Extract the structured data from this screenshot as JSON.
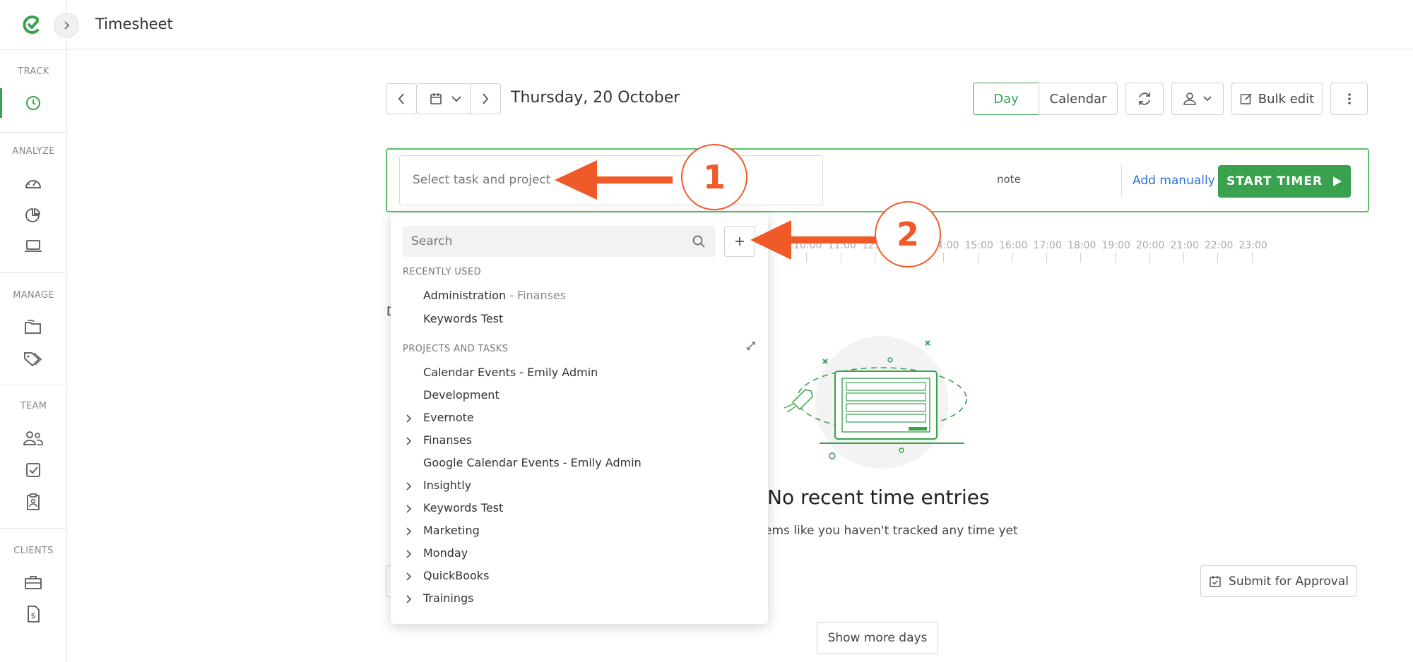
{
  "header": {
    "title": "Timesheet"
  },
  "sidebar": {
    "sections": [
      "TRACK",
      "ANALYZE",
      "MANAGE",
      "TEAM",
      "CLIENTS"
    ],
    "icons": [
      "clock-icon",
      "dashboard-icon",
      "report-icon",
      "activity-icon",
      "folder-icon",
      "tag-icon",
      "people-icon",
      "checkbox-icon",
      "clipboard-icon",
      "briefcase-icon",
      "invoice-icon"
    ]
  },
  "toolbar": {
    "date": "Thursday, 20 October",
    "view_day": "Day",
    "view_calendar": "Calendar",
    "bulk_edit": "Bulk edit"
  },
  "timer": {
    "task_placeholder": "Select task and project",
    "note": "note",
    "add_manually": "Add manually",
    "start_timer": "START TIMER"
  },
  "timeline": {
    "hours": [
      "10:00",
      "11:00",
      "12:00",
      "13:00",
      "14:00",
      "15:00",
      "16:00",
      "17:00",
      "18:00",
      "19:00",
      "20:00",
      "21:00",
      "22:00",
      "23:00"
    ]
  },
  "dropdown": {
    "search_placeholder": "Search",
    "recently_used_heading": "RECENTLY USED",
    "recently_used": [
      {
        "label": "Administration",
        "sub": " - Finanses"
      },
      {
        "label": "Keywords Test",
        "sub": ""
      }
    ],
    "projects_heading": "PROJECTS AND TASKS",
    "projects": [
      {
        "label": "Calendar Events - Emily Admin",
        "expandable": false
      },
      {
        "label": "Development",
        "expandable": false
      },
      {
        "label": "Evernote",
        "expandable": true
      },
      {
        "label": "Finanses",
        "expandable": true
      },
      {
        "label": "Google Calendar Events - Emily Admin",
        "expandable": false
      },
      {
        "label": "Insightly",
        "expandable": true
      },
      {
        "label": "Keywords Test",
        "expandable": true
      },
      {
        "label": "Marketing",
        "expandable": true
      },
      {
        "label": "Monday",
        "expandable": true
      },
      {
        "label": "QuickBooks",
        "expandable": true
      },
      {
        "label": "Trainings",
        "expandable": true
      }
    ]
  },
  "empty_state": {
    "title": "No recent time entries",
    "subtitle": "ems like you haven't tracked any time yet",
    "left_fragment": "D"
  },
  "footer": {
    "submit_for_approval": "Submit for Approval",
    "show_more_days": "Show more days"
  },
  "annotations": {
    "callout_1": "1",
    "callout_2": "2"
  },
  "colors": {
    "brand_green": "#3aa14e",
    "annotation_orange": "#f05a28",
    "link_blue": "#2d6fd6"
  }
}
